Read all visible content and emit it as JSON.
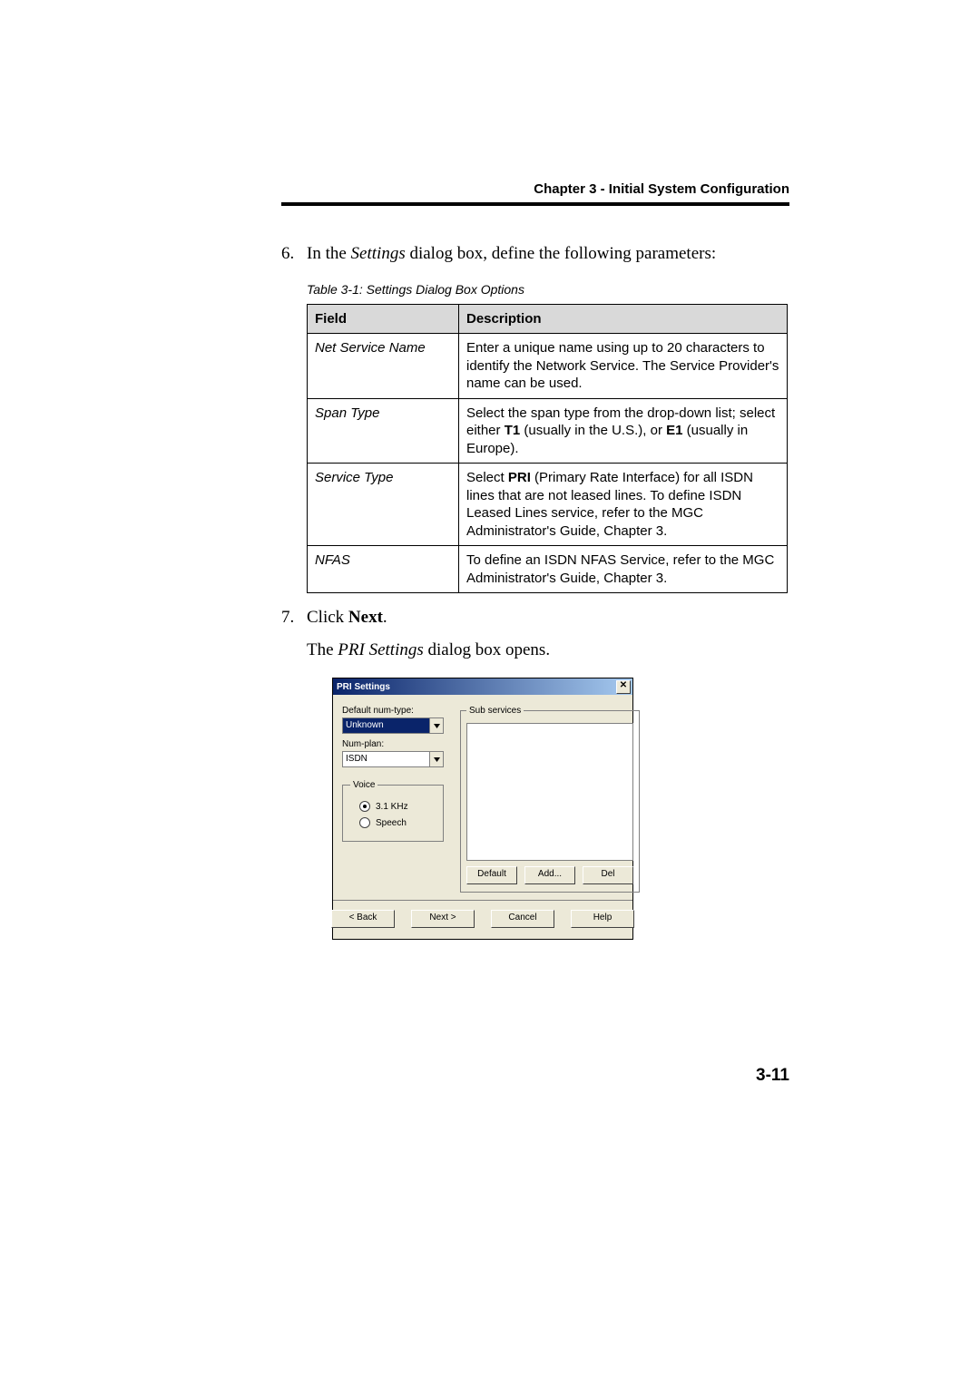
{
  "header": "Chapter 3 - Initial System Configuration",
  "step6": {
    "num": "6.",
    "pre": "In the ",
    "settings_word": "Settings",
    "post": " dialog box, define the following parameters:"
  },
  "table_caption": "Table 3-1: Settings Dialog Box Options",
  "table": {
    "col_field": "Field",
    "col_desc": "Description",
    "rows": [
      {
        "field": "Net Service Name",
        "desc_plain": "Enter a unique name using up to 20 characters to identify the Network Service. The Service Provider's name can be used."
      },
      {
        "field": "Span Type",
        "desc_pre": "Select the span type from the drop-down list; select either ",
        "b1": "T1",
        "mid1": " (usually in the U.S.), or ",
        "b2": "E1",
        "mid2": " (usually in Europe)."
      },
      {
        "field": "Service Type",
        "desc_pre": "Select ",
        "b1": "PRI",
        "mid1": " (Primary Rate Interface) for all ISDN lines that are not leased lines. To define ISDN Leased Lines service, refer to the MGC Administrator's Guide, Chapter 3."
      },
      {
        "field": "NFAS",
        "desc_plain": "To define an ISDN NFAS Service, refer to the MGC Administrator's Guide, Chapter 3."
      }
    ]
  },
  "step7": {
    "num": "7.",
    "click": "Click ",
    "next_word": "Next",
    "period": ".",
    "line2_pre": "The ",
    "line2_ital": "PRI Settings",
    "line2_post": " dialog box opens."
  },
  "dialog": {
    "title": "PRI Settings",
    "close_glyph": "✕",
    "default_num_type_label": "Default num-type:",
    "default_num_type_value": "Unknown",
    "num_plan_label": "Num-plan:",
    "num_plan_value": "ISDN",
    "voice_group": "Voice",
    "voice_opt1": "3.1 KHz",
    "voice_opt2": "Speech",
    "sub_services_group": "Sub services",
    "btn_default": "Default",
    "btn_add": "Add...",
    "btn_del": "Del",
    "btn_back": "< Back",
    "btn_next": "Next >",
    "btn_cancel": "Cancel",
    "btn_help": "Help"
  },
  "page_number": "3-11"
}
